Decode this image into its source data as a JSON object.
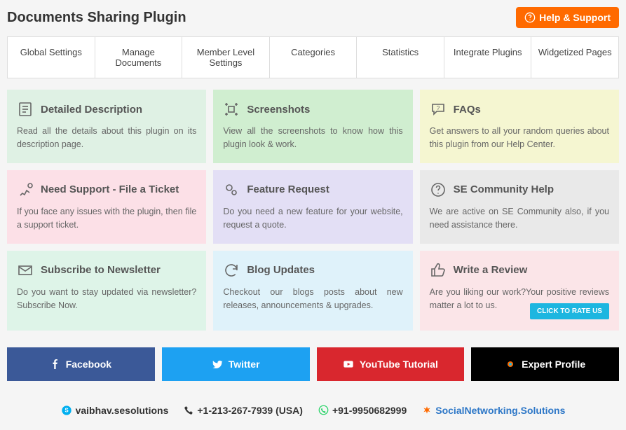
{
  "header": {
    "title": "Documents Sharing Plugin",
    "help_button": "Help & Support"
  },
  "tabs": [
    "Global Settings",
    "Manage Documents",
    "Member Level Settings",
    "Categories",
    "Statistics",
    "Integrate Plugins",
    "Widgetized Pages"
  ],
  "cards": [
    {
      "title": "Detailed Description",
      "desc": "Read all the details about this plugin on its description page."
    },
    {
      "title": "Screenshots",
      "desc": "View all the screenshots to know how this plugin look & work."
    },
    {
      "title": "FAQs",
      "desc": "Get answers to all your random queries about this plugin from our Help Center."
    },
    {
      "title": "Need Support - File a Ticket",
      "desc": "If you face any issues with the plugin, then file a support ticket."
    },
    {
      "title": "Feature Request",
      "desc": "Do you need a new feature for your website, request a quote."
    },
    {
      "title": "SE Community Help",
      "desc": "We are active on SE Community also, if you need assistance there."
    },
    {
      "title": "Subscribe to Newsletter",
      "desc": "Do you want to stay updated via newsletter? Subscribe Now."
    },
    {
      "title": "Blog Updates",
      "desc": "Checkout our blogs posts about new releases, announcements & upgrades."
    },
    {
      "title": "Write a Review",
      "desc": "Are you liking our work?Your positive reviews matter a lot to us.",
      "cta": "CLICK TO RATE US"
    }
  ],
  "socials": {
    "facebook": "Facebook",
    "twitter": "Twitter",
    "youtube": "YouTube Tutorial",
    "expert": "Expert Profile"
  },
  "footer": {
    "skype": "vaibhav.sesolutions",
    "phone_us": "+1-213-267-7939 (USA)",
    "whatsapp": "+91-9950682999",
    "site": "SocialNetworking.Solutions"
  }
}
